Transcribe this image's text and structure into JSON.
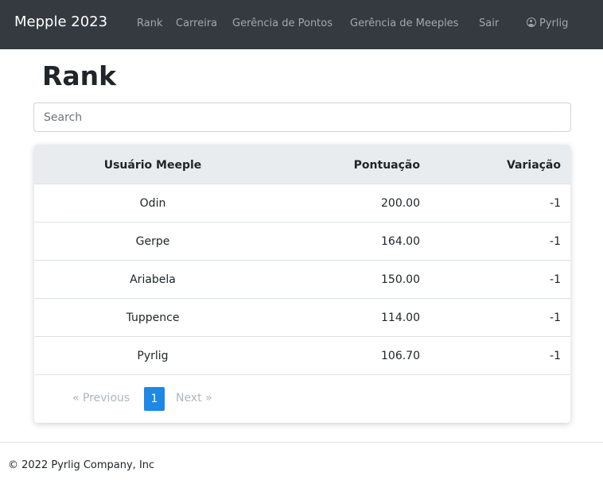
{
  "navbar": {
    "brand": "Mepple 2023",
    "links": [
      "Rank",
      "Carreira",
      "Gerência de Pontos",
      "Gerência de Meeples",
      "Sair"
    ],
    "user": "Pyrlig",
    "user_icon": "user-circle-icon"
  },
  "page": {
    "title": "Rank"
  },
  "search": {
    "placeholder": "Search",
    "value": ""
  },
  "table": {
    "headers": [
      "Usuário Meeple",
      "Pontuação",
      "Variação"
    ],
    "rows": [
      {
        "user": "Odin",
        "score": "200.00",
        "variation": "-1"
      },
      {
        "user": "Gerpe",
        "score": "164.00",
        "variation": "-1"
      },
      {
        "user": "Ariabela",
        "score": "150.00",
        "variation": "-1"
      },
      {
        "user": "Tuppence",
        "score": "114.00",
        "variation": "-1"
      },
      {
        "user": "Pyrlig",
        "score": "106.70",
        "variation": "-1"
      }
    ]
  },
  "pagination": {
    "previous": "« Previous",
    "current": "1",
    "next": "Next »"
  },
  "footer": {
    "text": "© 2022 Pyrlig Company, Inc"
  },
  "colors": {
    "navbar": "#343a40",
    "accent": "#1e88e5",
    "table_header": "#e9ecef"
  }
}
